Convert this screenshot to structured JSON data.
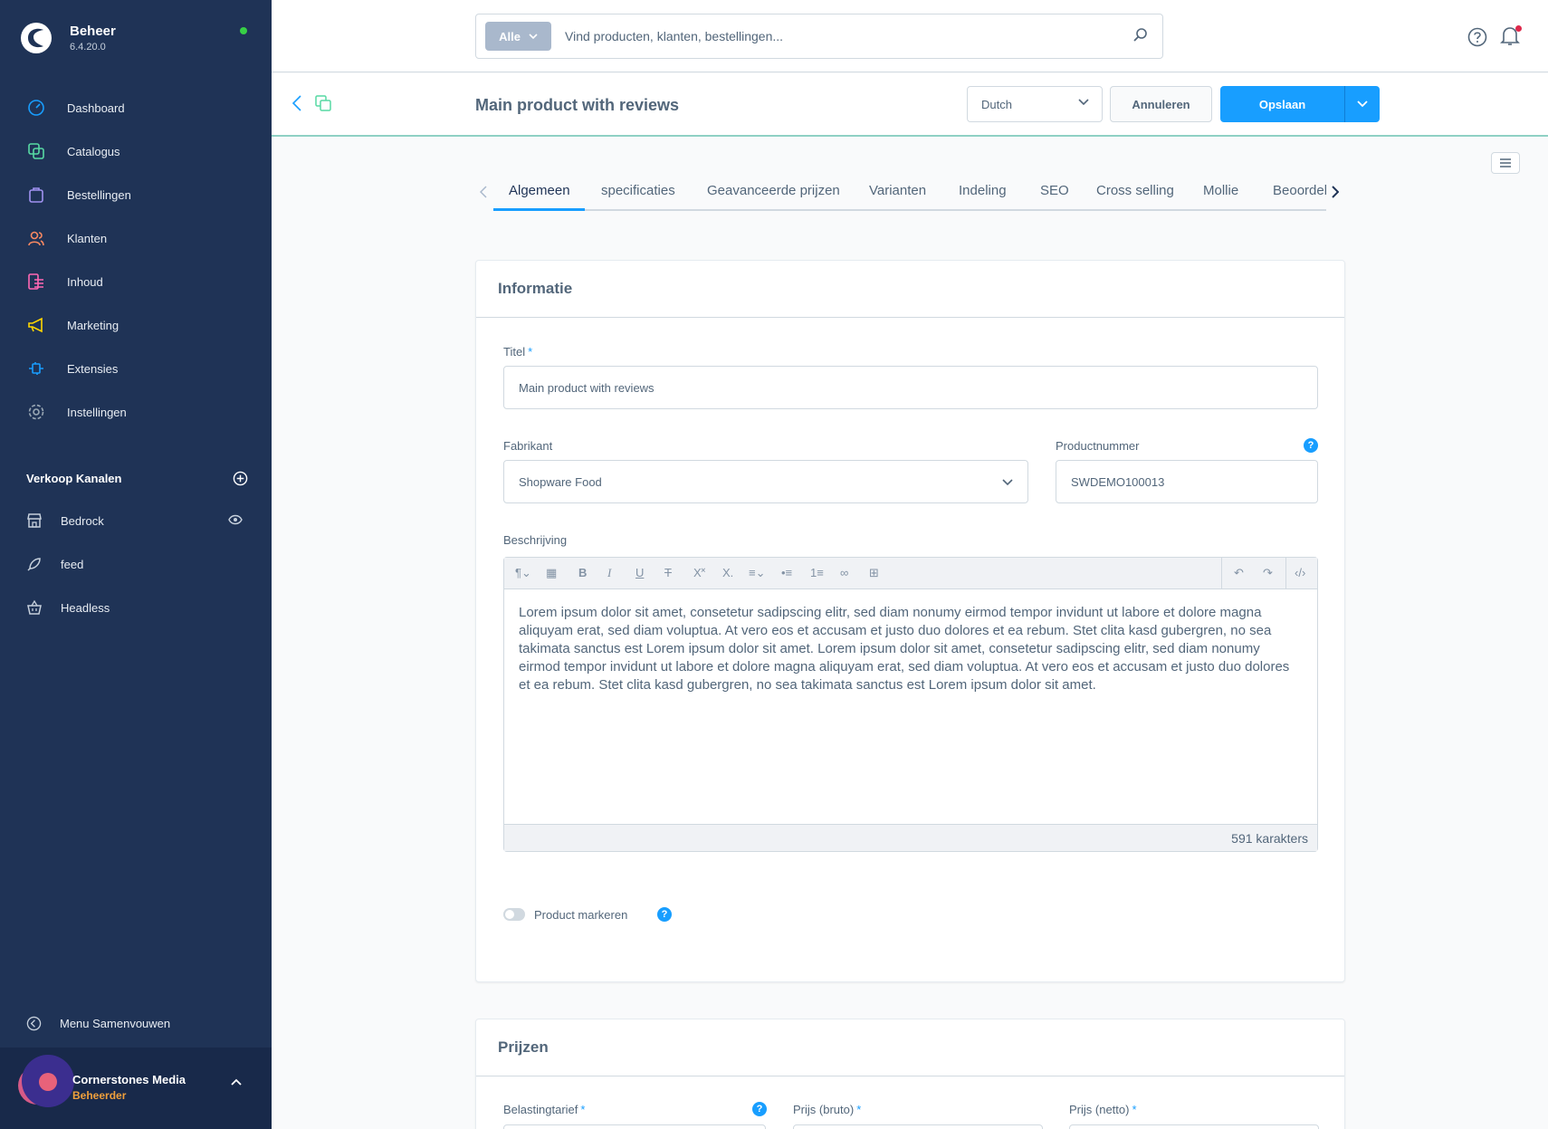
{
  "sidebar": {
    "brand": {
      "name": "Beheer",
      "version": "6.4.20.0"
    },
    "nav": [
      {
        "label": "Dashboard",
        "icon": "dashboard-icon",
        "color": "#189eff"
      },
      {
        "label": "Catalogus",
        "icon": "catalog-icon",
        "color": "#57d9a3"
      },
      {
        "label": "Bestellingen",
        "icon": "orders-icon",
        "color": "#a092f0"
      },
      {
        "label": "Klanten",
        "icon": "customers-icon",
        "color": "#f88962"
      },
      {
        "label": "Inhoud",
        "icon": "content-icon",
        "color": "#ff68b4"
      },
      {
        "label": "Marketing",
        "icon": "marketing-icon",
        "color": "#ffd700"
      },
      {
        "label": "Extensies",
        "icon": "extensions-icon",
        "color": "#189eff"
      },
      {
        "label": "Instellingen",
        "icon": "settings-icon",
        "color": "#9aa8b5"
      }
    ],
    "channels_title": "Verkoop Kanalen",
    "channels": [
      {
        "label": "Bedrock",
        "icon": "storefront-icon"
      },
      {
        "label": "feed",
        "icon": "rocket-icon"
      },
      {
        "label": "Headless",
        "icon": "basket-icon"
      }
    ],
    "collapse_label": "Menu Samenvouwen",
    "user": {
      "name": "Cornerstones Media",
      "role": "Beheerder"
    }
  },
  "topbar": {
    "search_type": "Alle",
    "search_placeholder": "Vind producten, klanten, bestellingen..."
  },
  "smartbar": {
    "title": "Main product with reviews",
    "language": "Dutch",
    "cancel_label": "Annuleren",
    "save_label": "Opslaan"
  },
  "tabs": [
    "Algemeen",
    "specificaties",
    "Geavanceerde prijzen",
    "Varianten",
    "Indeling",
    "SEO",
    "Cross selling",
    "Mollie",
    "Beoordel"
  ],
  "info_card": {
    "title": "Informatie",
    "title_label": "Titel",
    "title_value": "Main product with reviews",
    "manufacturer_label": "Fabrikant",
    "manufacturer_value": "Shopware Food",
    "product_number_label": "Productnummer",
    "product_number_value": "SWDEMO100013",
    "description_label": "Beschrijving",
    "description_text": "Lorem ipsum dolor sit amet, consetetur sadipscing elitr, sed diam nonumy eirmod tempor invidunt ut labore et dolore magna aliquyam erat, sed diam voluptua. At vero eos et accusam et justo duo dolores et ea rebum. Stet clita kasd gubergren, no sea takimata sanctus est Lorem ipsum dolor sit amet. Lorem ipsum dolor sit amet, consetetur sadipscing elitr, sed diam nonumy eirmod tempor invidunt ut labore et dolore magna aliquyam erat, sed diam voluptua. At vero eos et accusam et justo duo dolores et ea rebum. Stet clita kasd gubergren, no sea takimata sanctus est Lorem ipsum dolor sit amet.",
    "char_count": "591 karakters",
    "highlight_label": "Product markeren",
    "required_mark": "*",
    "help_mark": "?"
  },
  "price_card": {
    "title": "Prijzen",
    "tax_label": "Belastingtarief",
    "gross_label": "Prijs (bruto)",
    "net_label": "Prijs (netto)"
  },
  "colors": {
    "sidebar_bg": "#1f3356",
    "accent": "#189eff",
    "online": "#37d046"
  }
}
